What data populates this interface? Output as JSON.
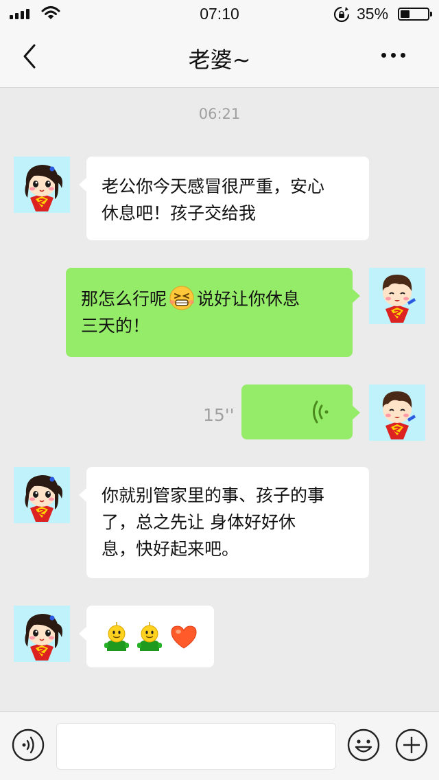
{
  "status_bar": {
    "time": "07:10",
    "battery_percent": "35%",
    "battery_level": 0.35,
    "signal_icon": "signal-bars-icon",
    "wifi_icon": "wifi-icon",
    "lock_icon": "rotation-lock-icon"
  },
  "header": {
    "title": "老婆~",
    "back_icon": "chevron-left-icon",
    "more_icon": "more-dots-icon"
  },
  "chat": {
    "timestamp": "06:21",
    "messages": [
      {
        "direction": "incoming",
        "type": "text",
        "lines": [
          "老公你今天感冒很严重，安心",
          "休息吧！孩子交给我"
        ]
      },
      {
        "direction": "outgoing",
        "type": "text",
        "line1_before": "那怎么行呢",
        "line1_emoji": "squinting-face-emoji",
        "line1_after": "说好让你休息",
        "line2": "三天的！"
      },
      {
        "direction": "outgoing",
        "type": "voice",
        "duration": "15''",
        "icon": "voice-wave-icon"
      },
      {
        "direction": "incoming",
        "type": "text",
        "lines": [
          "你就别管家里的事、孩子的事",
          "了，总之先让 身体好好休",
          "息，快好起来吧。"
        ]
      },
      {
        "direction": "incoming",
        "type": "stickers",
        "items": [
          "smiling-figure-emoji",
          "smiling-figure-emoji",
          "heart-emoji"
        ]
      }
    ]
  },
  "input_bar": {
    "text_value": "",
    "voice_icon": "voice-input-icon",
    "emoji_icon": "emoji-face-icon",
    "plus_icon": "plus-circle-icon"
  },
  "colors": {
    "outgoing_bubble": "#95ec69",
    "incoming_bubble": "#ffffff",
    "chat_background": "#ebebeb",
    "avatar_background": "#bff2fb"
  }
}
